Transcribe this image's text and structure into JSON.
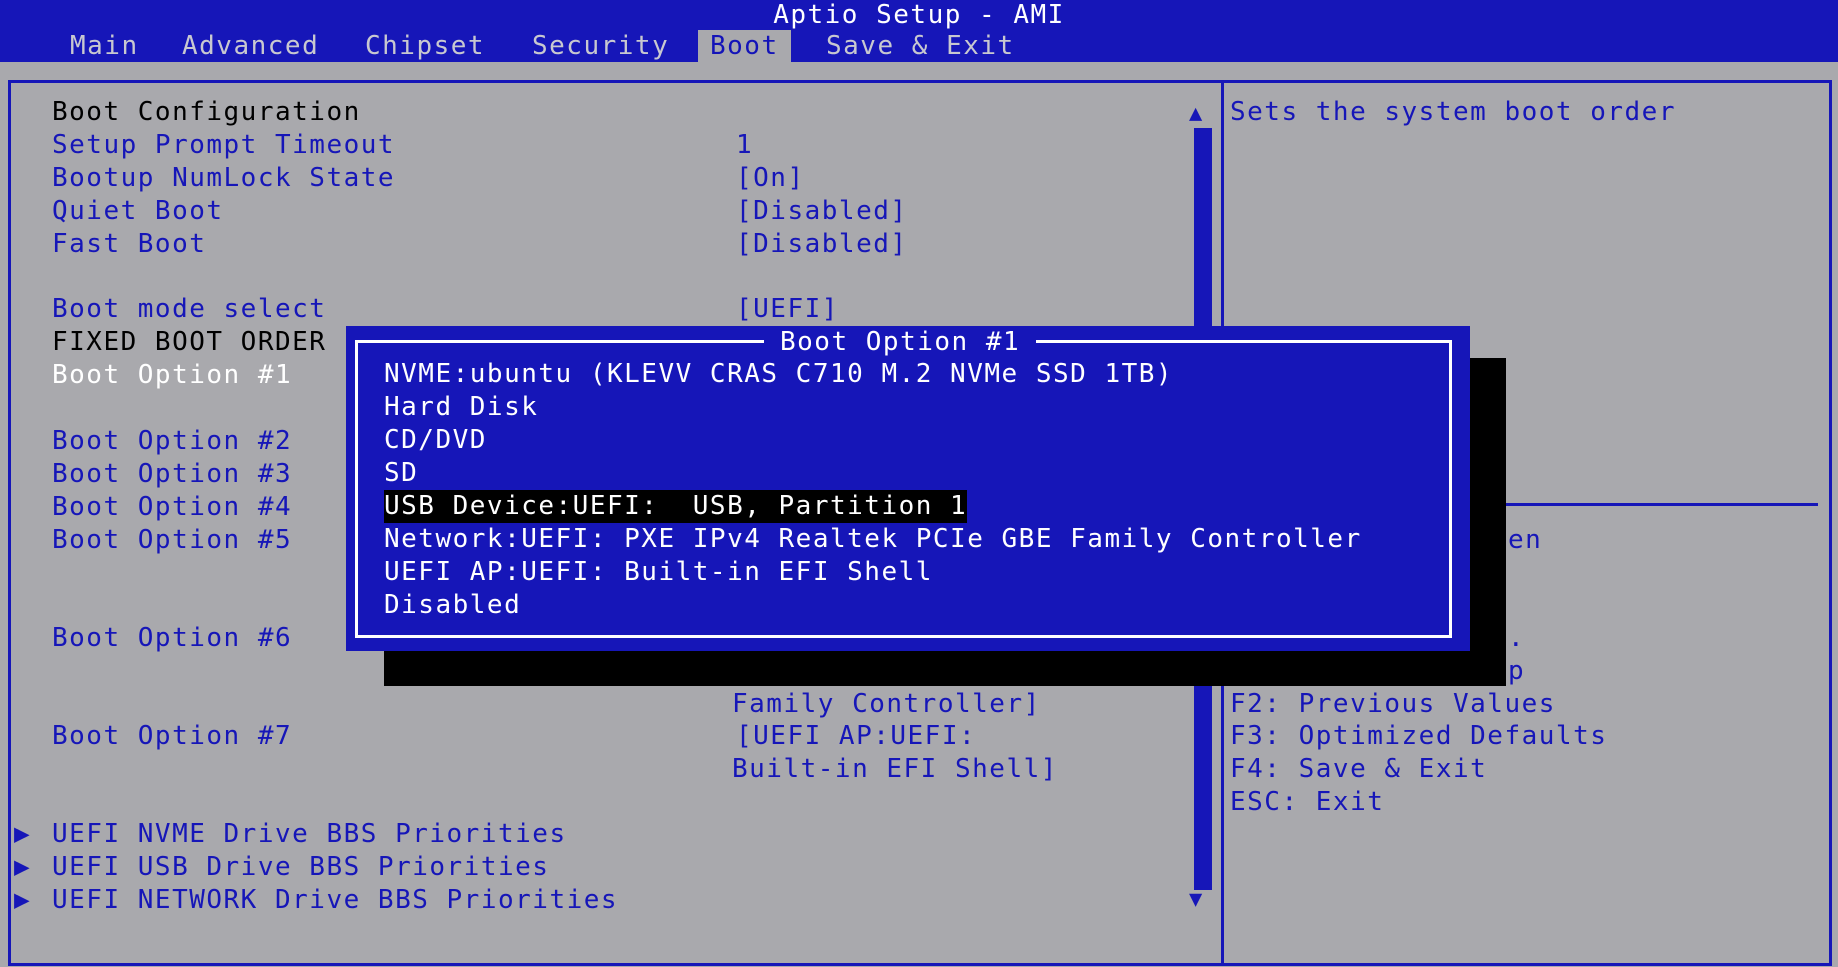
{
  "app": {
    "title": "Aptio Setup - AMI"
  },
  "tabs": [
    {
      "label": "Main"
    },
    {
      "label": "Advanced"
    },
    {
      "label": "Chipset"
    },
    {
      "label": "Security"
    },
    {
      "label": "Boot"
    },
    {
      "label": "Save & Exit"
    }
  ],
  "active_tab": "Boot",
  "settings": {
    "heading": "Boot Configuration",
    "setup_prompt_timeout": {
      "label": "Setup Prompt Timeout",
      "value": "1"
    },
    "numlock": {
      "label": "Bootup NumLock State",
      "value": "[On]"
    },
    "quiet_boot": {
      "label": "Quiet Boot",
      "value": "[Disabled]"
    },
    "fast_boot": {
      "label": "Fast Boot",
      "value": "[Disabled]"
    },
    "boot_mode": {
      "label": "Boot mode select",
      "value": "[UEFI]"
    },
    "fixed_order_heading": "FIXED BOOT ORDER",
    "boot_options": [
      {
        "label": "Boot Option #1"
      },
      {
        "label": "Boot Option #2"
      },
      {
        "label": "Boot Option #3"
      },
      {
        "label": "Boot Option #4"
      },
      {
        "label": "Boot Option #5"
      },
      {
        "label": "Boot Option #6",
        "value_tail": "Family Controller]"
      },
      {
        "label": "Boot Option #7",
        "value_line1": "[UEFI AP:UEFI:",
        "value_line2": "Built-in EFI Shell]"
      }
    ],
    "submenus": [
      {
        "label": "UEFI NVME Drive BBS Priorities"
      },
      {
        "label": "UEFI USB Drive BBS Priorities"
      },
      {
        "label": "UEFI NETWORK Drive BBS Priorities"
      }
    ],
    "submenu_marker": "▶"
  },
  "help": {
    "description": "Sets the system boot order",
    "partial_1": "en",
    "partial_2": ".",
    "partial_3": "p",
    "keys": [
      "F2: Previous Values",
      "F3: Optimized Defaults",
      "F4: Save & Exit",
      "ESC: Exit"
    ]
  },
  "popup": {
    "title": "Boot Option #1",
    "options": [
      "NVME:ubuntu (KLEVV CRAS C710 M.2 NVMe SSD 1TB)",
      "Hard Disk",
      "CD/DVD",
      "SD",
      "USB Device:UEFI:  USB, Partition 1",
      "Network:UEFI: PXE IPv4 Realtek PCIe GBE Family Controller",
      "UEFI AP:UEFI: Built-in EFI Shell",
      "Disabled"
    ],
    "selected_index": 4
  },
  "scroll": {
    "up_arrow": "▲",
    "down_arrow": "▼"
  },
  "colors": {
    "bios_blue": "#1616b8",
    "panel_gray": "#a9a9ad",
    "highlight": "#000000",
    "text_white": "#ffffff"
  }
}
